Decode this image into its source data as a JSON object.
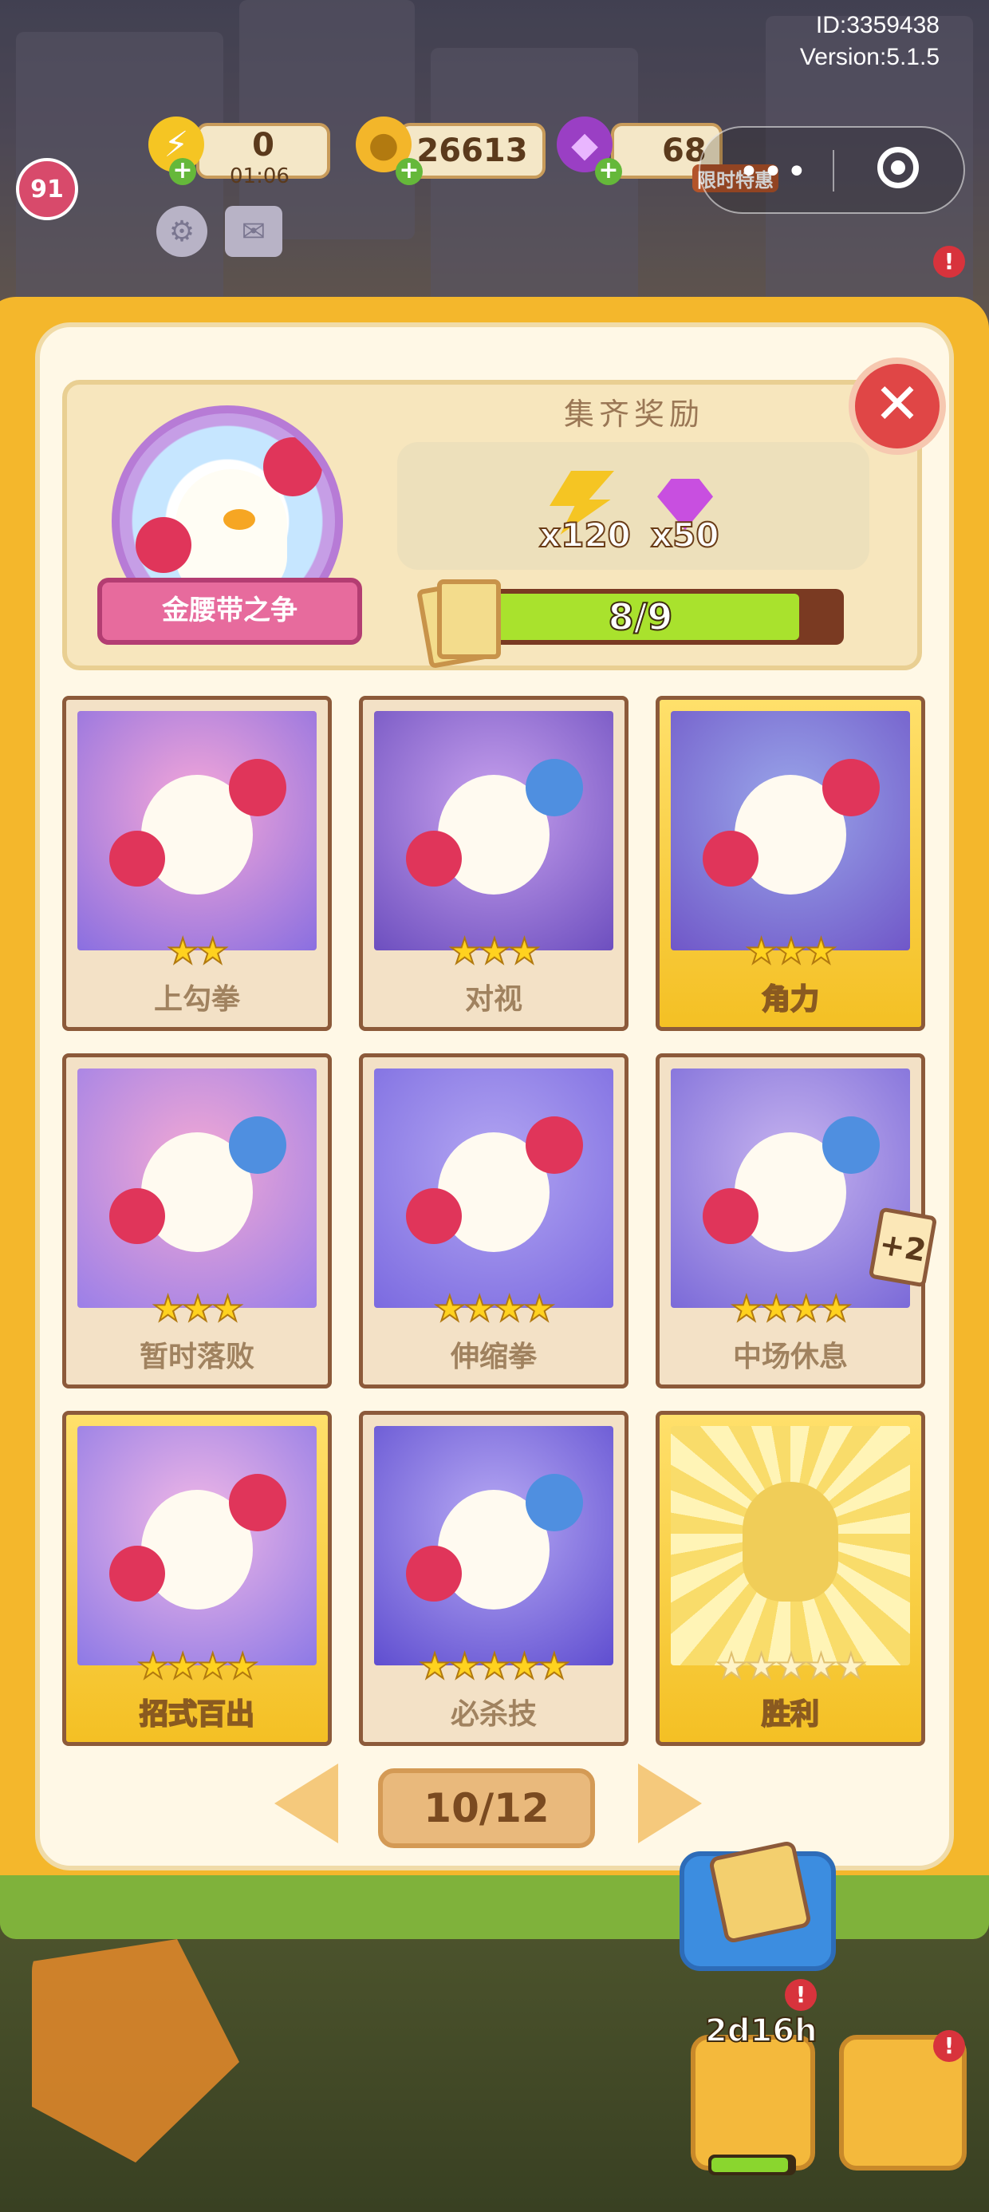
{
  "game_info": {
    "id": "ID:3359438",
    "version": "Version:5.1.5"
  },
  "hud": {
    "level": "91",
    "energy": {
      "value": "0",
      "timer": "01:06"
    },
    "coins": "26613",
    "gems": "68",
    "promo_label": "限时特惠"
  },
  "miniprogram_capsule": {
    "more_icon": "more-dots-icon",
    "close_icon": "target-icon"
  },
  "album": {
    "set_name": "金腰带之争",
    "reward_title": "集齐奖励",
    "rewards": [
      {
        "icon": "energy-bolt-icon",
        "amount": "x120",
        "color": "#f5c523"
      },
      {
        "icon": "gem-icon",
        "amount": "x50",
        "color": "#c84fe0"
      }
    ],
    "progress": {
      "text": "8/9",
      "collected": 8,
      "total": 9
    },
    "close_icon": "close-icon"
  },
  "cards": [
    {
      "name": "上勾拳",
      "stars": 2,
      "golden": false,
      "collected": true
    },
    {
      "name": "对视",
      "stars": 3,
      "golden": false,
      "collected": true
    },
    {
      "name": "角力",
      "stars": 3,
      "golden": true,
      "collected": true
    },
    {
      "name": "暂时落败",
      "stars": 3,
      "golden": false,
      "collected": true
    },
    {
      "name": "伸缩拳",
      "stars": 4,
      "golden": false,
      "collected": true
    },
    {
      "name": "中场休息",
      "stars": 4,
      "golden": false,
      "collected": true,
      "duplicate": "+2"
    },
    {
      "name": "招式百出",
      "stars": 4,
      "golden": true,
      "collected": true
    },
    {
      "name": "必杀技",
      "stars": 5,
      "golden": false,
      "collected": true
    },
    {
      "name": "胜利",
      "stars": 5,
      "golden": true,
      "collected": false
    }
  ],
  "pagination": {
    "text": "10/12",
    "current": 10,
    "total": 12
  },
  "bottom_bar": {
    "timer": "2d16h",
    "alert": "!"
  },
  "colors": {
    "panel": "#fff8e6",
    "book": "#f4b72c",
    "close": "#e04646",
    "progress": "#a9e22d"
  }
}
